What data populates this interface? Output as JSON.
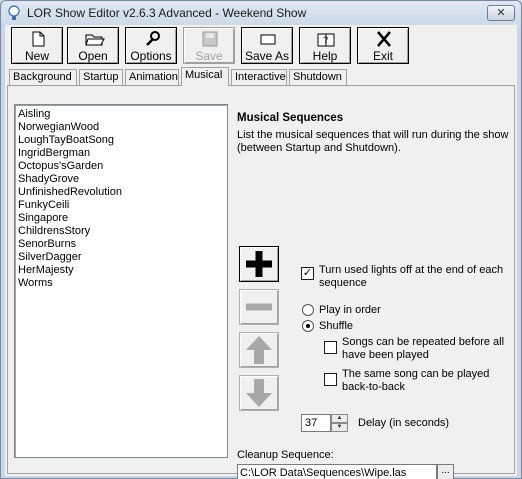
{
  "window": {
    "title": "LOR Show Editor v2.6.3 Advanced - Weekend Show",
    "close_label": "✕"
  },
  "toolbar": {
    "buttons": [
      {
        "label": "New",
        "icon": "new-file-icon"
      },
      {
        "label": "Open",
        "icon": "open-folder-icon"
      },
      {
        "label": "Options",
        "icon": "wrench-icon"
      },
      {
        "label": "Save",
        "icon": "floppy-disk-icon",
        "disabled": true
      },
      {
        "label": "Save As",
        "icon": "save-as-icon"
      },
      {
        "label": "Help",
        "icon": "help-icon"
      },
      {
        "label": "Exit",
        "icon": "close-icon"
      }
    ]
  },
  "tabs": [
    {
      "label": "Background"
    },
    {
      "label": "Startup"
    },
    {
      "label": "Animation"
    },
    {
      "label": "Musical",
      "active": true
    },
    {
      "label": "Interactive"
    },
    {
      "label": "Shutdown"
    }
  ],
  "sequences": [
    "Aisling",
    "NorwegianWood",
    "LoughTayBoatSong",
    "IngridBergman",
    "Octopus'sGarden",
    "ShadyGrove",
    "UnfinishedRevolution",
    "FunkyCeili",
    "Singapore",
    "ChildrensStory",
    "SenorBurns",
    "SilverDagger",
    "HerMajesty",
    "Worms"
  ],
  "section": {
    "heading": "Musical Sequences",
    "description": "List the musical sequences that will run during the show (between Startup and Shutdown)."
  },
  "options": {
    "turn_off_label": "Turn used lights off at the end of each sequence",
    "turn_off_checked": true,
    "play_in_order_label": "Play in order",
    "shuffle_label": "Shuffle",
    "selected_mode": "Shuffle",
    "repeat_label": "Songs can be repeated before all have been played",
    "repeat_checked": false,
    "back_to_back_label": "The same song can be played back-to-back",
    "back_to_back_checked": false
  },
  "delay": {
    "value": "37",
    "label": "Delay (in seconds)"
  },
  "cleanup": {
    "label": "Cleanup Sequence:",
    "value": "C:\\LOR Data\\Sequences\\Wipe.las",
    "browse_label": "..."
  },
  "colors": {
    "enabled_icon": "#000000",
    "disabled_icon": "#a8a8a8"
  }
}
